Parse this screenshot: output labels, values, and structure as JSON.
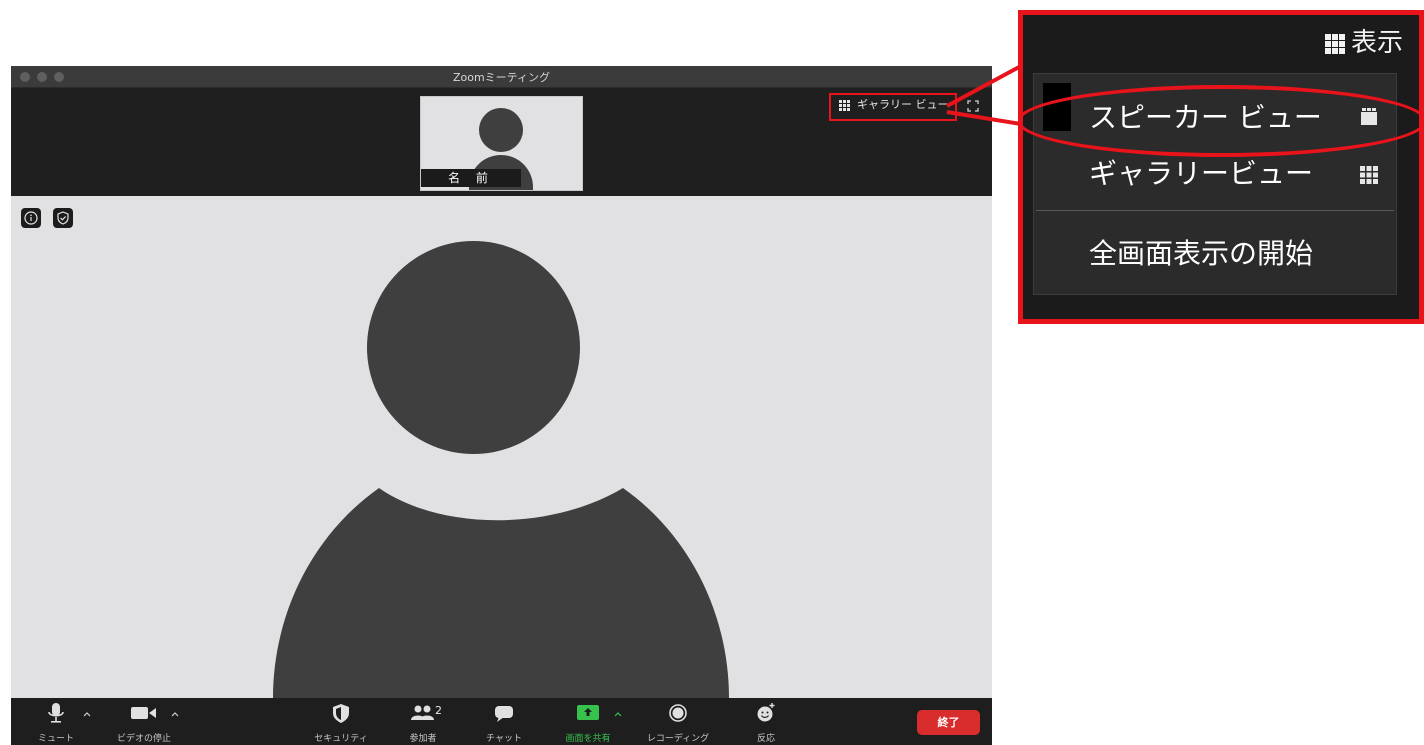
{
  "window": {
    "title": "Zoomミーティング"
  },
  "thumbnail": {
    "name": "名 前"
  },
  "topbar": {
    "gallery_view_label": "ギャラリー ビュー"
  },
  "toolbar": {
    "mute_label": "ミュート",
    "video_label": "ビデオの停止",
    "security_label": "セキュリティ",
    "participants_label": "参加者",
    "participants_count": "2",
    "chat_label": "チャット",
    "share_label": "画面を共有",
    "record_label": "レコーディング",
    "reactions_label": "反応",
    "end_label": "終了"
  },
  "callout": {
    "view_label": "表示",
    "menu_items": [
      "スピーカー ビュー",
      "ギャラリービュー",
      "全画面表示の開始"
    ]
  },
  "colors": {
    "highlight_red": "#e8131b",
    "share_green": "#37c24d",
    "end_red": "#d92c2c",
    "avatar_gray": "#3f3f3f",
    "video_bg": "#e1e1e4"
  }
}
